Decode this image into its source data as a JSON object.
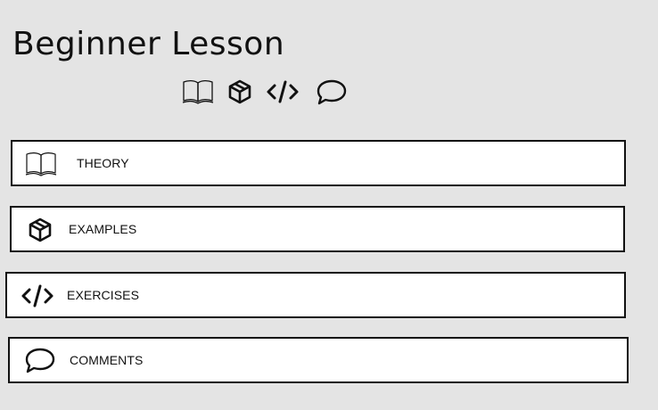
{
  "lesson": {
    "title": "Beginner Lesson"
  },
  "header_icons": [
    "book-icon",
    "cube-icon",
    "code-icon",
    "comment-icon"
  ],
  "sections": [
    {
      "label": "THEORY",
      "icon": "book-icon"
    },
    {
      "label": "EXAMPLES",
      "icon": "cube-icon"
    },
    {
      "label": "EXERCISES",
      "icon": "code-icon"
    },
    {
      "label": "COMMENTS",
      "icon": "comment-icon"
    }
  ]
}
